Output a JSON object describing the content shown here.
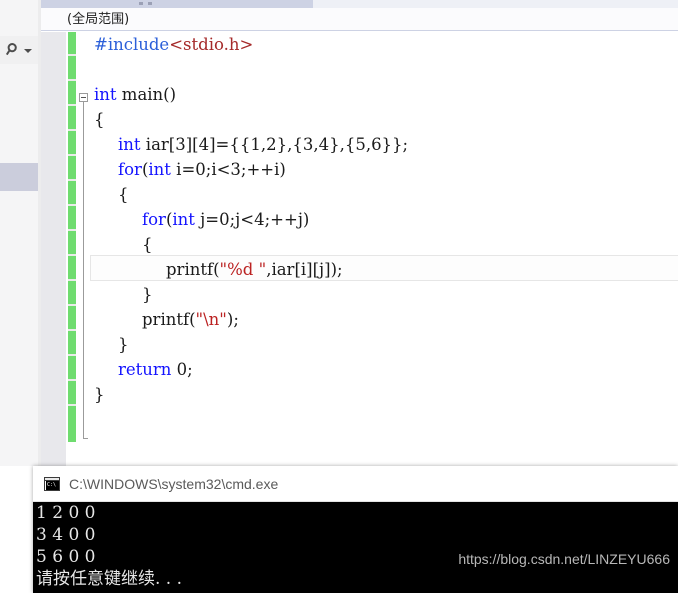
{
  "ide": {
    "tabstrip": {
      "dots_label": "tab-overflow-dots"
    },
    "scope_bar": {
      "scope": "(全局范围)"
    },
    "tools": {
      "search_icon": "search-icon",
      "search_dropdown_icon": "chevron-down-icon"
    },
    "fold_icon": "collapse-minus-icon",
    "code_lines": [
      {
        "indent": 0,
        "tokens": [
          {
            "t": "#include",
            "c": "pre"
          },
          {
            "t": "<stdio.h>",
            "c": "hdr"
          }
        ]
      },
      {
        "indent": 0,
        "tokens": []
      },
      {
        "indent": 0,
        "tokens": [
          {
            "t": "int",
            "c": "kw"
          },
          {
            "t": " main()",
            "c": "pun"
          }
        ]
      },
      {
        "indent": 0,
        "tokens": [
          {
            "t": "{",
            "c": "pun"
          }
        ]
      },
      {
        "indent": 1,
        "tokens": [
          {
            "t": "int",
            "c": "kw"
          },
          {
            "t": " iar[3][4]={{1,2},{3,4},{5,6}};",
            "c": "pun"
          }
        ]
      },
      {
        "indent": 1,
        "tokens": [
          {
            "t": "for",
            "c": "kw"
          },
          {
            "t": "(",
            "c": "pun"
          },
          {
            "t": "int",
            "c": "kw"
          },
          {
            "t": " i=0;i<3;++i)",
            "c": "pun"
          }
        ]
      },
      {
        "indent": 1,
        "tokens": [
          {
            "t": "{",
            "c": "pun"
          }
        ]
      },
      {
        "indent": 2,
        "tokens": [
          {
            "t": "for",
            "c": "kw"
          },
          {
            "t": "(",
            "c": "pun"
          },
          {
            "t": "int",
            "c": "kw"
          },
          {
            "t": " j=0;j<4;++j)",
            "c": "pun"
          }
        ]
      },
      {
        "indent": 2,
        "tokens": [
          {
            "t": "{",
            "c": "pun"
          }
        ]
      },
      {
        "indent": 3,
        "tokens": [
          {
            "t": "printf(",
            "c": "pun"
          },
          {
            "t": "\"%d \"",
            "c": "str"
          },
          {
            "t": ",iar[i][j]);",
            "c": "pun"
          }
        ]
      },
      {
        "indent": 2,
        "tokens": [
          {
            "t": "}",
            "c": "pun"
          }
        ]
      },
      {
        "indent": 2,
        "tokens": [
          {
            "t": "printf(",
            "c": "pun"
          },
          {
            "t": "\"\\n\"",
            "c": "str"
          },
          {
            "t": ");",
            "c": "pun"
          }
        ]
      },
      {
        "indent": 1,
        "tokens": [
          {
            "t": "}",
            "c": "pun"
          }
        ]
      },
      {
        "indent": 1,
        "tokens": [
          {
            "t": "return",
            "c": "kw"
          },
          {
            "t": " 0;",
            "c": "pun"
          }
        ]
      },
      {
        "indent": 0,
        "tokens": [
          {
            "t": "}",
            "c": "pun"
          }
        ]
      }
    ],
    "current_line_index": 7
  },
  "console": {
    "icon": "cmd-terminal-icon",
    "title": "C:\\WINDOWS\\system32\\cmd.exe",
    "output": [
      "1 2 0 0",
      "3 4 0 0",
      "5 6 0 0",
      "请按任意键继续. . ."
    ],
    "watermark": "https://blog.csdn.net/LINZEYU666"
  },
  "colors": {
    "keyword": "#1414ff",
    "preprocessor": "#2b5fd9",
    "string": "#bb2222",
    "header": "#a52a2a",
    "change_bar": "#6fdc6f",
    "tab_active": "#cdd2e4",
    "strip_selected": "#cbcddc"
  }
}
